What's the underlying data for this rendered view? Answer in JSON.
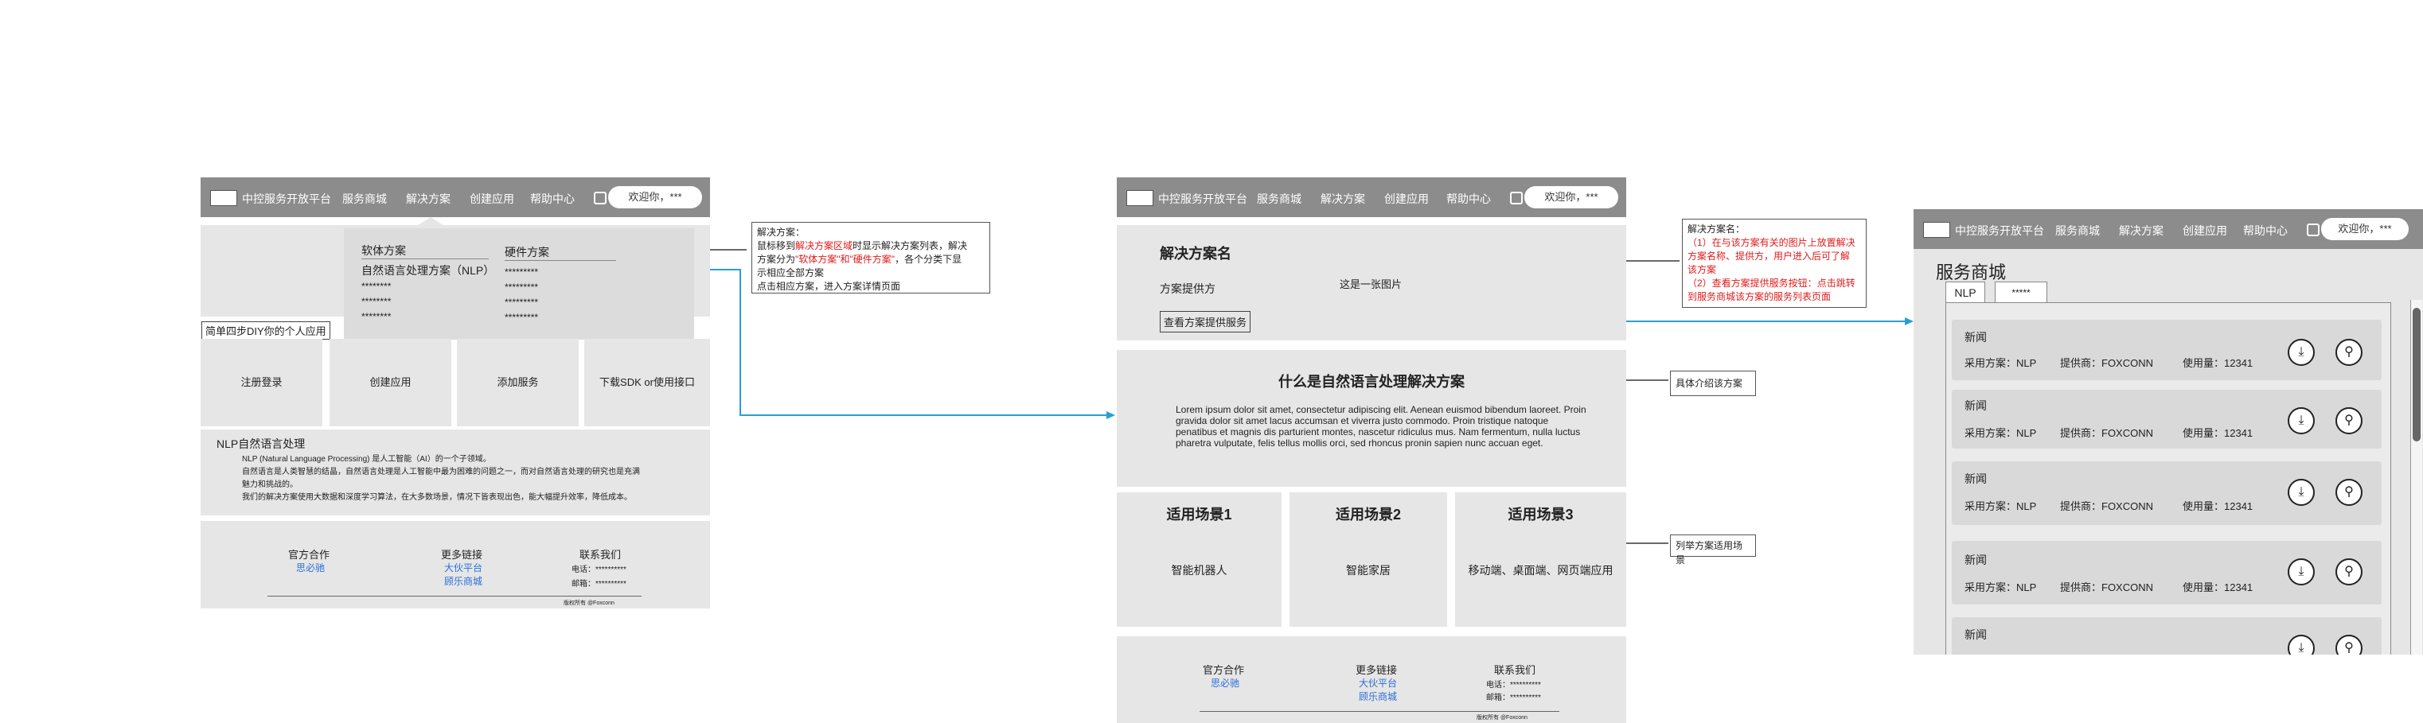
{
  "colors": {
    "nav": "#8c8c8c",
    "panel": "#e6e6e6",
    "card": "#d9d9d9",
    "link": "#2a6fdb",
    "annotation_red": "#e01b1b",
    "connector": "#2a9fd6"
  },
  "nav": {
    "brand": "中控服务开放平台",
    "items": [
      "服务商城",
      "解决方案",
      "创建应用",
      "帮助中心"
    ],
    "welcome": "欢迎你，***"
  },
  "screen1": {
    "dropdown": {
      "col1_header": "软体方案",
      "col2_header": "硬件方案",
      "col1_items": [
        "自然语言处理方案（NLP）",
        "********",
        "********",
        "********"
      ],
      "col2_items": [
        "*********",
        "*********",
        "*********",
        "*********"
      ]
    },
    "diy_label": "简单四步DIY你的个人应用",
    "steps": [
      "注册登录",
      "创建应用",
      "添加服务",
      "下载SDK or使用接口"
    ],
    "nlp_title": "NLP自然语言处理",
    "nlp_lines": [
      "NLP (Natural Language Processing) 是人工智能（AI）的一个子领域。",
      "自然语言是人类智慧的结晶，自然语言处理是人工智能中最为困难的问题之一，而对自然语言处理的研究也是充满",
      "魅力和挑战的。",
      "我们的解决方案使用大数据和深度学习算法，在大多数场景，情况下皆表现出色，能大幅提升效率，降低成本。"
    ]
  },
  "footer": {
    "col1_title": "官方合作",
    "col1_link": "思必驰",
    "col2_title": "更多链接",
    "col2_links": [
      "大伙平台",
      "顾乐商城"
    ],
    "col3_title": "联系我们",
    "phone": "电话：**********",
    "email": "邮箱：**********",
    "copyright": "版权所有 @Foxconn"
  },
  "note1": {
    "line1": "解决方案：",
    "line2a": "鼠标移到",
    "line2b": "解决方案区域",
    "line2c": "时显示解决方案列表，解决",
    "line3a": "方案分为",
    "line3b": "\"软体方案\"和\"硬件方案\"",
    "line3c": "，各个分类下显",
    "line4": "示相应全部方案",
    "line5": "点击相应方案，进入方案详情页面"
  },
  "screen2": {
    "solution_name": "解决方案名",
    "provider": "方案提供方",
    "image_placeholder": "这是一张图片",
    "view_button": "查看方案提供服务",
    "section_title": "什么是自然语言处理解决方案",
    "lorem": "Lorem ipsum dolor sit amet, consectetur adipiscing elit. Aenean euismod bibendum laoreet. Proin gravida dolor sit amet lacus accumsan et viverra justo commodo. Proin tristique natoque penatibus et magnis dis parturient montes, nascetur ridiculus mus. Nam fermentum, nulla luctus pharetra vulputate, felis tellus mollis orci, sed rhoncus pronin sapien nunc accuan eget.",
    "scenarios": [
      {
        "title": "适用场景1",
        "value": "智能机器人"
      },
      {
        "title": "适用场景2",
        "value": "智能家居"
      },
      {
        "title": "适用场景3",
        "value": "移动端、桌面端、网页端应用"
      }
    ]
  },
  "note2": {
    "line1": "解决方案名：",
    "line2": "（1）在与该方案有关的图片上放置解决",
    "line3": "方案名称、提供方，用户进入后可了解",
    "line4": "该方案",
    "line5a": "（2）查看方案提供服务按钮：",
    "line5b": "点击跳转",
    "line6": "到服务商城该方案的服务列表页面"
  },
  "note3": "具体介绍该方案",
  "note4": "列举方案适用场景",
  "screen3": {
    "title": "服务商城",
    "tabs": [
      "NLP",
      "*****"
    ],
    "services": [
      {
        "name": "新闻",
        "scheme": "采用方案：NLP",
        "provider": "提供商：FOXCONN",
        "usage": "使用量：12341"
      },
      {
        "name": "新闻",
        "scheme": "采用方案：NLP",
        "provider": "提供商：FOXCONN",
        "usage": "使用量：12341"
      },
      {
        "name": "新闻",
        "scheme": "采用方案：NLP",
        "provider": "提供商：FOXCONN",
        "usage": "使用量：12341"
      },
      {
        "name": "新闻",
        "scheme": "采用方案：NLP",
        "provider": "提供商：FOXCONN",
        "usage": "使用量：12341"
      },
      {
        "name": "新闻",
        "scheme": "",
        "provider": "",
        "usage": ""
      }
    ]
  }
}
